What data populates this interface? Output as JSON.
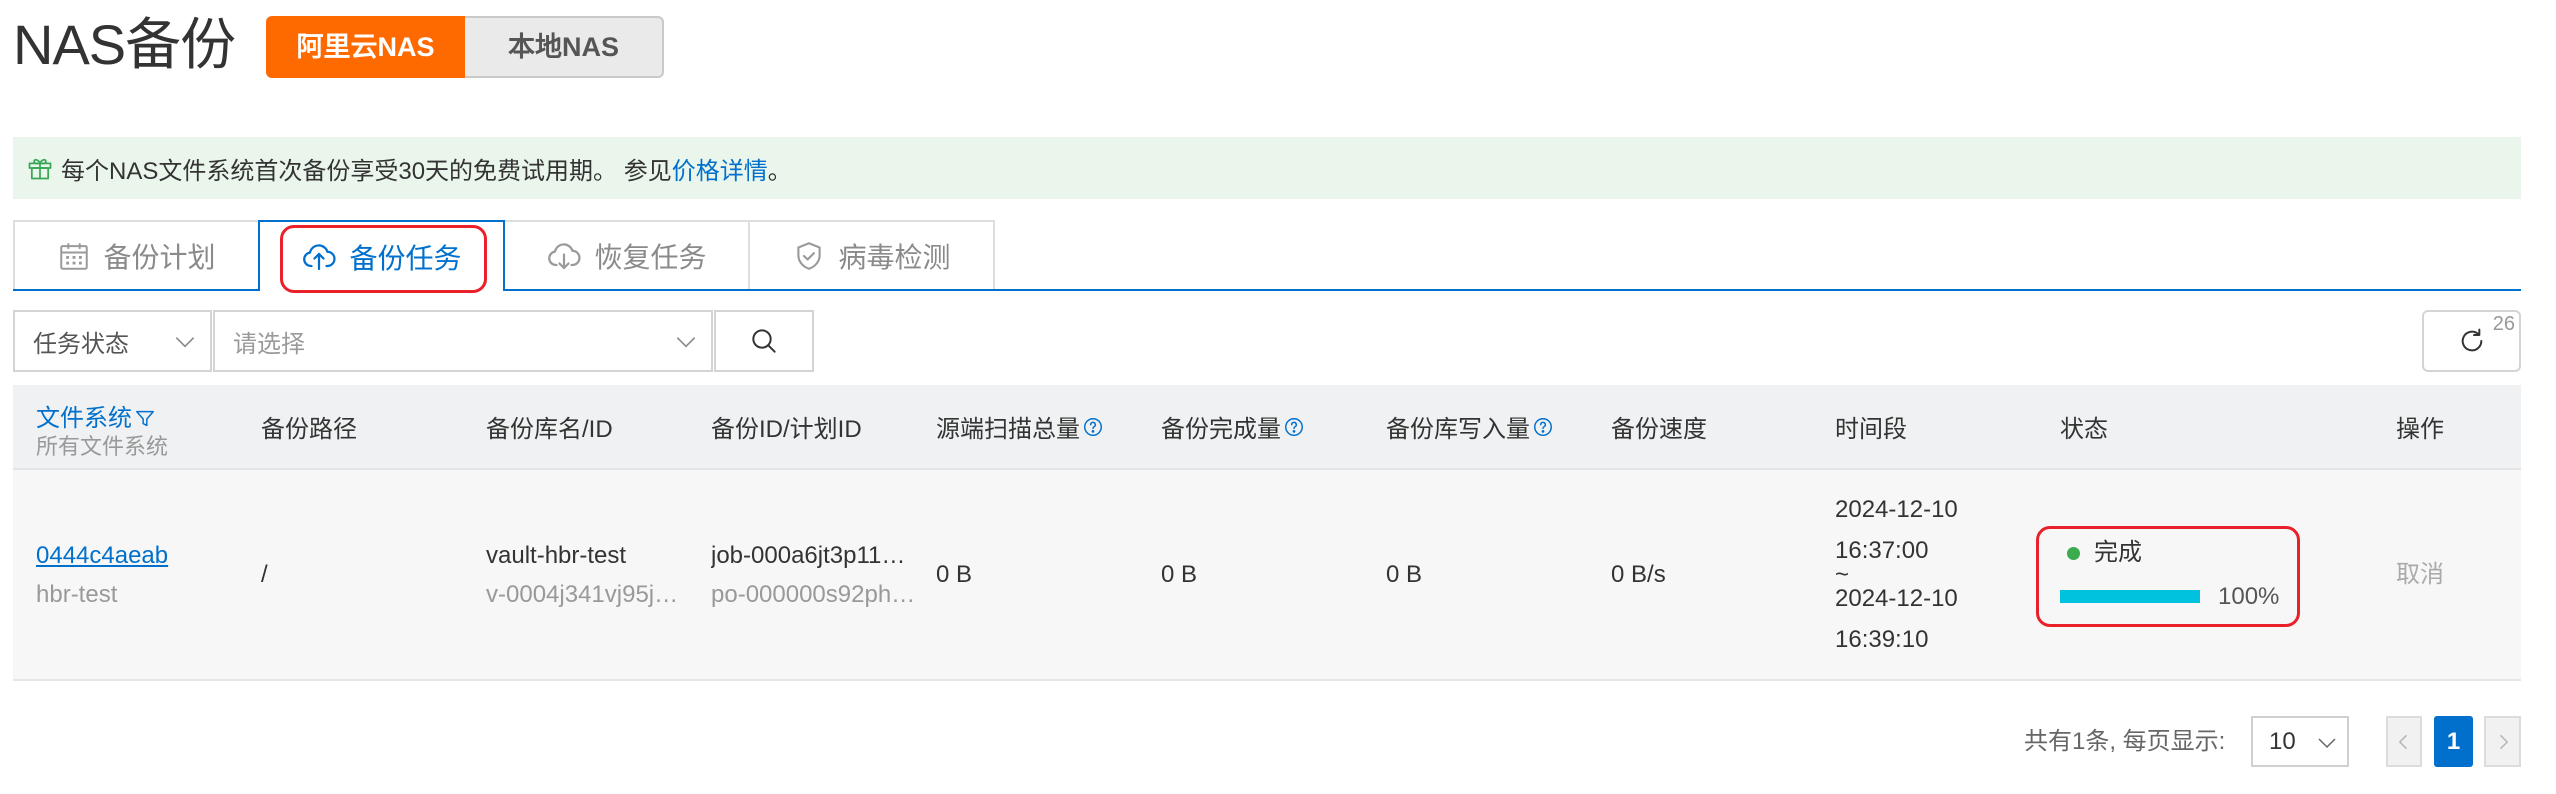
{
  "page": {
    "title": "NAS备份"
  },
  "theme": {
    "accent_orange": "#ff6a00",
    "link_blue": "#0070cc",
    "progress_cyan": "#00c1de",
    "success_green": "#3aab4e",
    "highlight_red": "#e8212b",
    "banner_green": "#eaf6ec"
  },
  "nas_toggle": {
    "options": [
      {
        "label": "阿里云NAS",
        "selected": true
      },
      {
        "label": "本地NAS",
        "selected": false
      }
    ]
  },
  "banner": {
    "icon": "gift-icon",
    "text": "每个NAS文件系统首次备份享受30天的免费试用期。 参见",
    "link_text": "价格详情",
    "suffix": "。"
  },
  "tabs": [
    {
      "label": "备份计划",
      "icon": "calendar-icon",
      "active": false
    },
    {
      "label": "备份任务",
      "icon": "cloud-upload-icon",
      "active": true
    },
    {
      "label": "恢复任务",
      "icon": "cloud-download-icon",
      "active": false
    },
    {
      "label": "病毒检测",
      "icon": "shield-check-icon",
      "active": false
    }
  ],
  "filters": {
    "field_select": "任务状态",
    "value_placeholder": "请选择",
    "search_icon": "search-icon"
  },
  "refresh": {
    "icon": "refresh-icon",
    "badge": "26"
  },
  "table": {
    "columns": [
      {
        "label": "文件系统",
        "sub_label": "所有文件系统",
        "filter_icon": "filter-icon"
      },
      {
        "label": "备份路径"
      },
      {
        "label": "备份库名/ID"
      },
      {
        "label": "备份ID/计划ID"
      },
      {
        "label": "源端扫描总量",
        "help_icon": "help-icon"
      },
      {
        "label": "备份完成量",
        "help_icon": "help-icon"
      },
      {
        "label": "备份库写入量",
        "help_icon": "help-icon"
      },
      {
        "label": "备份速度"
      },
      {
        "label": "时间段"
      },
      {
        "label": "状态"
      },
      {
        "label": "操作"
      }
    ],
    "rows": [
      {
        "file_system": {
          "id": "0444c4aeab",
          "name": "hbr-test"
        },
        "backup_path": "/",
        "vault": {
          "name": "vault-hbr-test",
          "id": "v-0004j341vj95j…"
        },
        "job": {
          "job_id": "job-000a6jt3p11…",
          "plan_id": "po-000000s92ph…"
        },
        "source_scanned": "0 B",
        "backup_completed": "0 B",
        "vault_written": "0 B",
        "speed": "0 B/s",
        "time_range": {
          "start_date": "2024-12-10",
          "start_time": "16:37:00",
          "separator": "~",
          "end_date": "2024-12-10",
          "end_time": "16:39:10"
        },
        "status": {
          "label": "完成",
          "progress_percent": 100,
          "progress_text": "100%"
        },
        "action": "取消"
      }
    ]
  },
  "pagination": {
    "summary": "共有1条, 每页显示:",
    "page_size": "10",
    "current_page": "1",
    "prev_icon": "chevron-left-icon",
    "next_icon": "chevron-right-icon"
  }
}
